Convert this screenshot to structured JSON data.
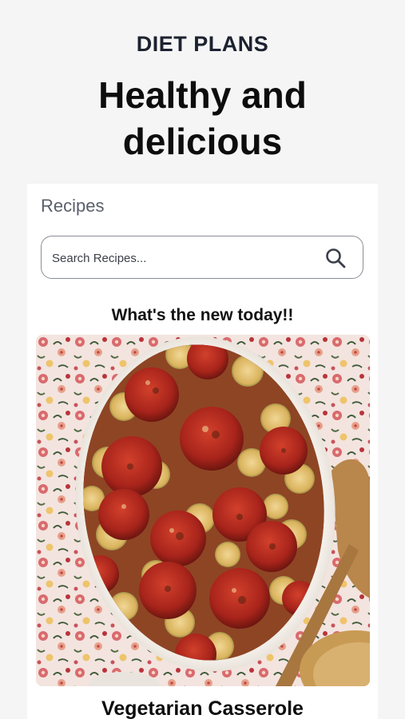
{
  "header": {
    "eyebrow": "DIET PLANS",
    "title_line1": "Healthy and",
    "title_line2": "delicious"
  },
  "recipes": {
    "section_label": "Recipes",
    "search": {
      "placeholder": "Search Recipes...",
      "value": "",
      "icon": "search-icon"
    },
    "featured_heading": "What's the new today!!",
    "featured": {
      "title": "Vegetarian Casserole",
      "image_subject": "vegetable-casserole-photo"
    }
  },
  "colors": {
    "background": "#f5f5f5",
    "card": "#ffffff",
    "text": "#111111",
    "muted": "#5a5f6b"
  }
}
